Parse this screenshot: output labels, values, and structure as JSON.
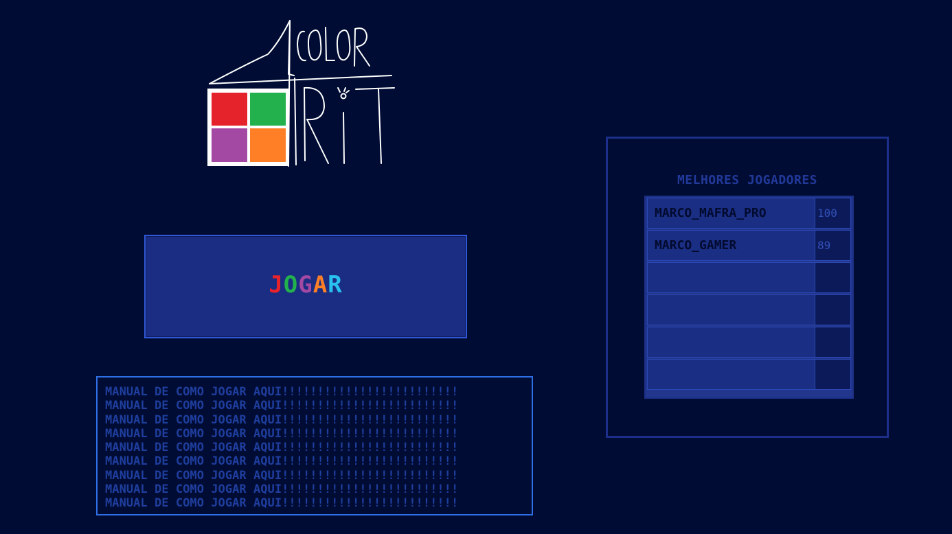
{
  "colors": {
    "background": "#000c33",
    "logo_stroke": "#ffffff",
    "square_red": "#e5232b",
    "square_green": "#22b14c",
    "square_purple": "#a349a4",
    "square_orange": "#ff7f27",
    "button_fill": "#1a2d82",
    "button_border": "#2f57d6"
  },
  "play_button": {
    "letters": [
      {
        "char": "J",
        "color": "#e8232b"
      },
      {
        "char": "O",
        "color": "#22b14c"
      },
      {
        "char": "G",
        "color": "#a349a4"
      },
      {
        "char": "A",
        "color": "#ff7f27"
      },
      {
        "char": "R",
        "color": "#29c1ef"
      }
    ]
  },
  "manual": {
    "lines": [
      "MANUAL DE COMO JOGAR AQUI!!!!!!!!!!!!!!!!!!!!!!!!!",
      "MANUAL DE COMO JOGAR AQUI!!!!!!!!!!!!!!!!!!!!!!!!!",
      "MANUAL DE COMO JOGAR AQUI!!!!!!!!!!!!!!!!!!!!!!!!!",
      "MANUAL DE COMO JOGAR AQUI!!!!!!!!!!!!!!!!!!!!!!!!!",
      "MANUAL DE COMO JOGAR AQUI!!!!!!!!!!!!!!!!!!!!!!!!!",
      "MANUAL DE COMO JOGAR AQUI!!!!!!!!!!!!!!!!!!!!!!!!!",
      "MANUAL DE COMO JOGAR AQUI!!!!!!!!!!!!!!!!!!!!!!!!!",
      "MANUAL DE COMO JOGAR AQUI!!!!!!!!!!!!!!!!!!!!!!!!!",
      "MANUAL DE COMO JOGAR AQUI!!!!!!!!!!!!!!!!!!!!!!!!!"
    ]
  },
  "leaderboard": {
    "title": "MELHORES JOGADORES",
    "rows": [
      {
        "name": "MARCO_MAFRA_PRO",
        "score": "100"
      },
      {
        "name": "MARCO_GAMER",
        "score": "89"
      },
      {
        "name": "",
        "score": ""
      },
      {
        "name": "",
        "score": ""
      },
      {
        "name": "",
        "score": ""
      },
      {
        "name": "",
        "score": ""
      }
    ]
  }
}
